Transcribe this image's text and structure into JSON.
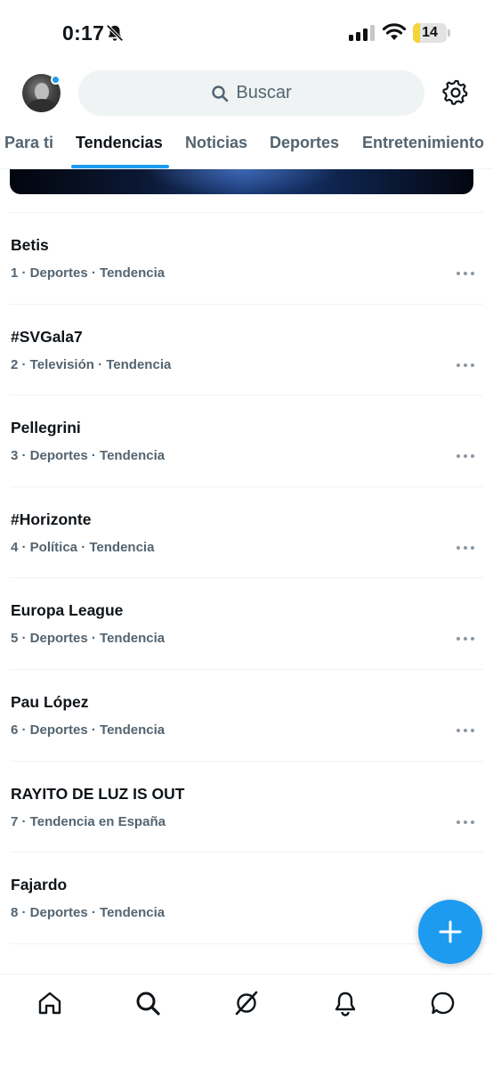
{
  "status_bar": {
    "time": "0:17",
    "battery_level": "14",
    "battery_fill_fraction": 0.22
  },
  "header": {
    "search": {
      "placeholder": "Buscar"
    }
  },
  "tabs": [
    {
      "label": "Para ti",
      "active": false
    },
    {
      "label": "Tendencias",
      "active": true
    },
    {
      "label": "Noticias",
      "active": false
    },
    {
      "label": "Deportes",
      "active": false
    },
    {
      "label": "Entretenimiento",
      "active": false
    }
  ],
  "trends": [
    {
      "title": "Betis",
      "meta": "1 · Deportes · Tendencia"
    },
    {
      "title": "#SVGala7",
      "meta": "2 · Televisión · Tendencia"
    },
    {
      "title": "Pellegrini",
      "meta": "3 · Deportes · Tendencia"
    },
    {
      "title": "#Horizonte",
      "meta": "4 · Política · Tendencia"
    },
    {
      "title": "Europa League",
      "meta": "5 · Deportes · Tendencia"
    },
    {
      "title": "Pau López",
      "meta": "6 · Deportes · Tendencia"
    },
    {
      "title": "RAYITO DE LUZ IS OUT",
      "meta": "7 · Tendencia en España"
    },
    {
      "title": "Fajardo",
      "meta": "8 · Deportes · Tendencia"
    }
  ],
  "bottom_nav": [
    {
      "icon": "home-icon"
    },
    {
      "icon": "search-icon"
    },
    {
      "icon": "grok-icon"
    },
    {
      "icon": "notifications-bell-icon"
    },
    {
      "icon": "messages-icon"
    }
  ],
  "colors": {
    "accent": "#1d9bf0",
    "text_primary": "#0f1419",
    "text_secondary": "#536471",
    "divider": "#eff3f4",
    "battery_low": "#f5d33a"
  }
}
